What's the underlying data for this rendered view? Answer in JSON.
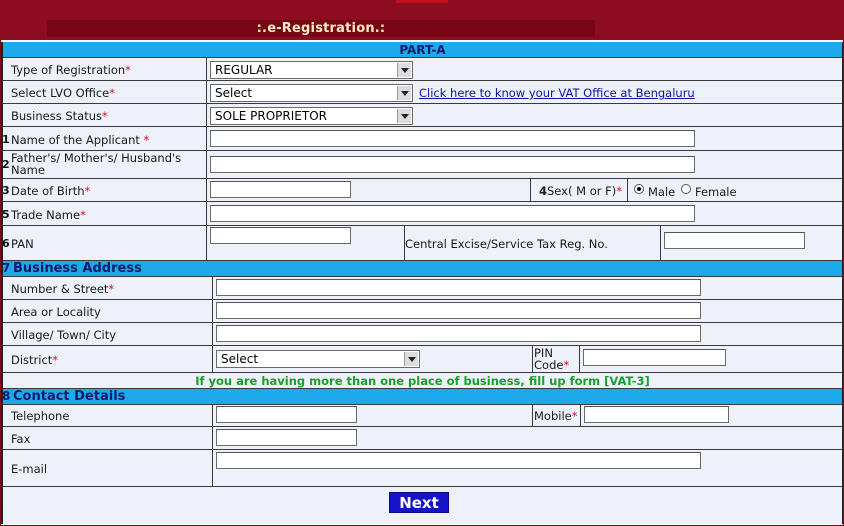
{
  "page": {
    "title": ":.e-Registration.:"
  },
  "part": {
    "header": "PART-A"
  },
  "fields": {
    "registration_type": {
      "label": "Type of Registration",
      "req": "*",
      "value": "REGULAR"
    },
    "lvo_office": {
      "label": "Select LVO Office",
      "req": "*",
      "value": "Select",
      "link": "Click here to know your VAT Office at Bengaluru"
    },
    "business_status": {
      "label": "Business Status",
      "req": "*",
      "value": "SOLE PROPRIETOR"
    },
    "applicant_name": {
      "num": "1",
      "label": "Name of the Applicant ",
      "req": "*",
      "value": ""
    },
    "guardian_name": {
      "num": "2",
      "label_line1": "Father's/ Mother's/ Husband's",
      "label_line2": "Name",
      "value": ""
    },
    "dob": {
      "num": "3",
      "label": "Date of Birth",
      "req": "*",
      "value": ""
    },
    "sex": {
      "num": "4",
      "label": "Sex( M or F)",
      "req": "*",
      "option_male": "Male",
      "option_female": "Female",
      "selected": "Male"
    },
    "trade_name": {
      "num": "5",
      "label": "Trade Name",
      "req": "*",
      "value": ""
    },
    "pan": {
      "num": "6",
      "label": "PAN",
      "value": "",
      "excise_label": "Central Excise/Service Tax Reg. No.",
      "excise_value": ""
    }
  },
  "business_address": {
    "num": "7",
    "heading": "Business Address",
    "street": {
      "label": "Number & Street",
      "req": "*"
    },
    "area": {
      "label": "Area or Locality"
    },
    "village": {
      "label": "Village/ Town/ City"
    },
    "district": {
      "label": "District",
      "req": "*",
      "value": "Select"
    },
    "pin": {
      "label_line1": "PIN",
      "label_line2": "Code",
      "req": "*"
    }
  },
  "notice": "If you are having more than one place of business, fill up form [VAT-3]",
  "contact": {
    "num": "8",
    "heading": "Contact Details",
    "telephone": {
      "label": "Telephone"
    },
    "mobile": {
      "label": "Mobile",
      "req": "*"
    },
    "fax": {
      "label": "Fax"
    },
    "email": {
      "label": "E-mail"
    }
  },
  "actions": {
    "next_label": "Next"
  },
  "colors": {
    "section_blue": "#1ea9ec",
    "form_bg": "#eef0fa",
    "banner_red": "#8e0c1f",
    "required_red": "#d0131f",
    "notice_green": "#15a12a",
    "next_blue": "#1513c8"
  }
}
